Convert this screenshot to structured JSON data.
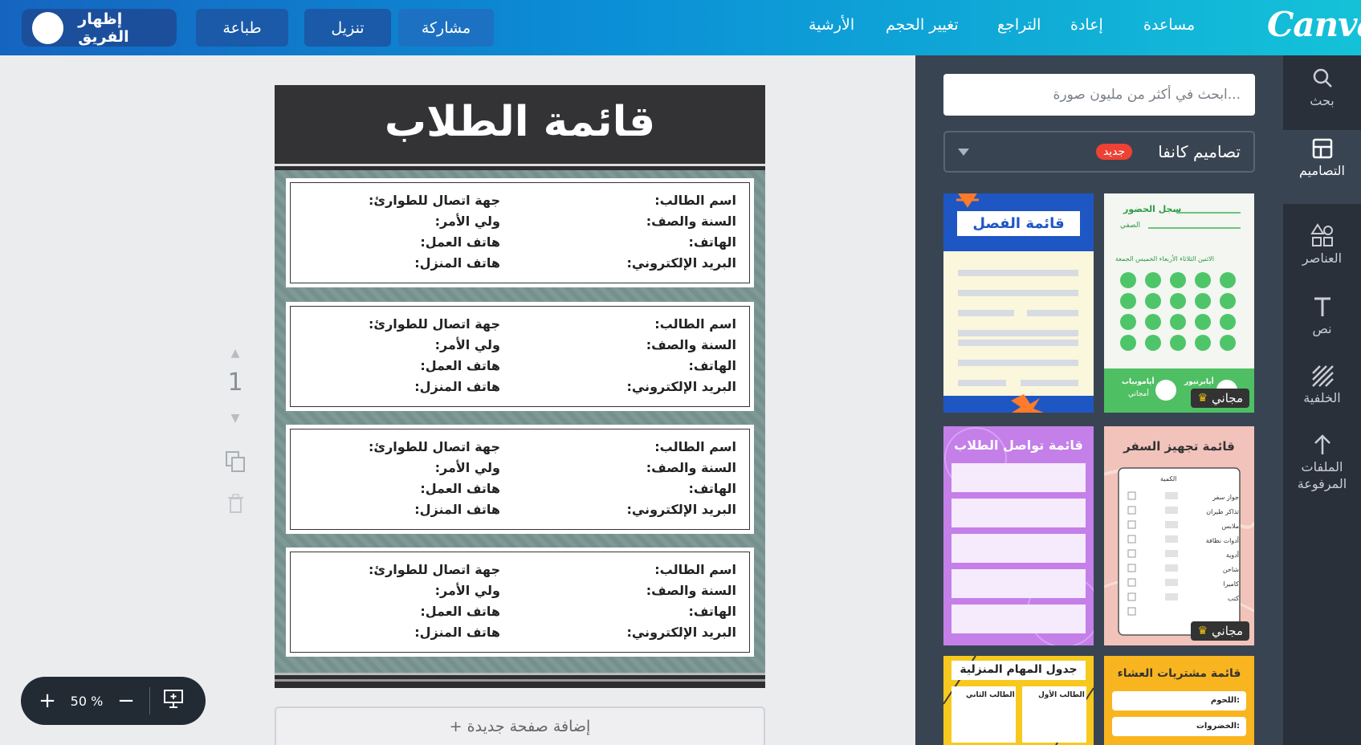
{
  "topbar": {
    "logo": "Canva",
    "menu": {
      "help": "مساعدة",
      "redo": "إعادة",
      "undo": "التراجع",
      "resize": "تغيير الحجم",
      "archive": "الأرشية"
    },
    "share": "مشاركة",
    "download": "تنزيل",
    "print": "طباعة",
    "show_team": "إظهار الفريق"
  },
  "rail": {
    "search": "بحث",
    "templates": "التصاميم",
    "elements": "العناصر",
    "text": "نص",
    "background": "الخلفية",
    "uploads_1": "الملفات",
    "uploads_2": "المرفوعة"
  },
  "panel": {
    "search_placeholder": "ابحث في أكثر من مليون صورة...",
    "category": "تصاميم كانفا",
    "new_badge": "جديد",
    "free_label": "مجاني",
    "templates": {
      "t1_title": "قائمة الفصل",
      "t2_title": "سجل الحضور",
      "t2_sub": "الصفي",
      "t2_days": "الاثنين  الثلاثاء  الأربعاء  الخميس  الجمعة",
      "t2_foot_a": "أيابرتيور",
      "t2_foot_b": "أياموبياب",
      "t2_foot_c": "أمجاني",
      "t3_title": "قائمة تواصل الطلاب",
      "t4_title": "قائمة تجهيز السفر",
      "t4_head": "الكمية",
      "t4_items": [
        "جواز سفر",
        "تذاكر طيران",
        "ملابس",
        "أدوات نظافة",
        "أدوية",
        "شاحن",
        "كاميرا",
        "كتب"
      ],
      "t5_title": "جدول المهام المنزلية",
      "t5_col_a": "الطالب الأول",
      "t5_col_b": "الطالب الثاني",
      "t6_title": "قائمة مشتريات العشاء",
      "t6_f1": "اللحوم:",
      "t6_f2": "الخضروات:"
    }
  },
  "document": {
    "title": "قائمة الطلاب",
    "fields": {
      "student_name": "اسم الطالب:",
      "year_class": "السنة والصف:",
      "phone": "الهاتف:",
      "email": "البريد الإلكتروني:",
      "emergency": "جهة اتصال للطوارئ:",
      "guardian": "ولي الأمر:",
      "work_phone": "هاتف العمل:",
      "home_phone": "هاتف المنزل:"
    }
  },
  "page_number": "1",
  "add_page": "+ إضافة صفحة جديدة",
  "zoom": {
    "value": "50 %",
    "plus": "+",
    "minus": "−"
  }
}
